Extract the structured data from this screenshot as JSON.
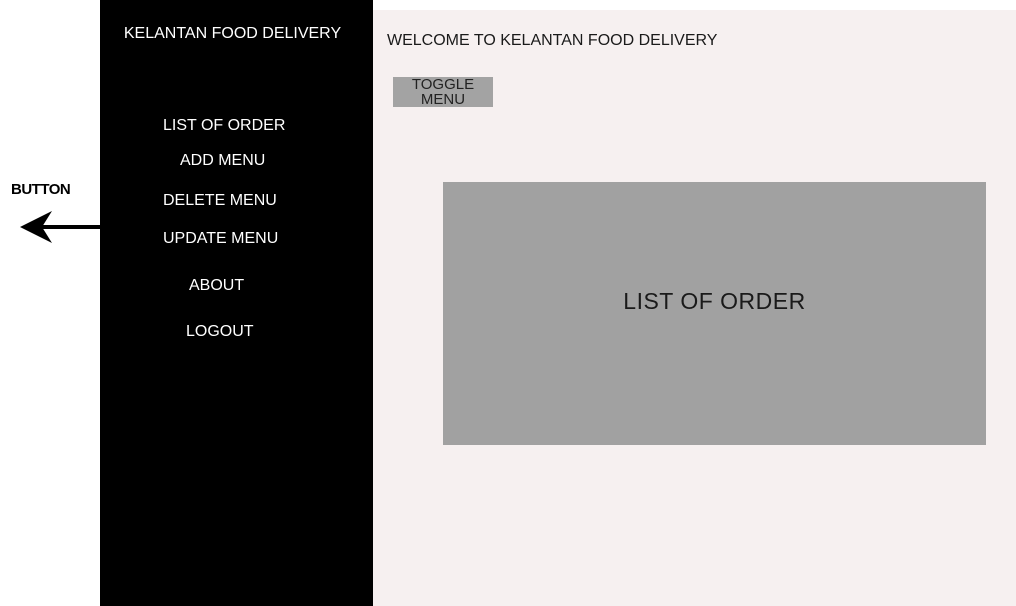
{
  "annotation": {
    "label": "BUTTON",
    "arrow_icon": "arrow-left-icon"
  },
  "sidebar": {
    "title": "KELANTAN FOOD DELIVERY",
    "items": [
      {
        "label": "LIST OF ORDER"
      },
      {
        "label": "ADD MENU"
      },
      {
        "label": "DELETE MENU"
      },
      {
        "label": "UPDATE MENU"
      },
      {
        "label": "ABOUT"
      },
      {
        "label": "LOGOUT"
      }
    ]
  },
  "main": {
    "welcome": "WELCOME TO KELANTAN FOOD DELIVERY",
    "toggle_line1": "TOGGLE",
    "toggle_line2": "MENU",
    "panel_title": "LIST OF ORDER"
  },
  "colors": {
    "sidebar_bg": "#000000",
    "main_bg": "#f6f0f0",
    "panel_bg": "#a1a1a1",
    "toggle_bg": "#a3a3a3"
  }
}
